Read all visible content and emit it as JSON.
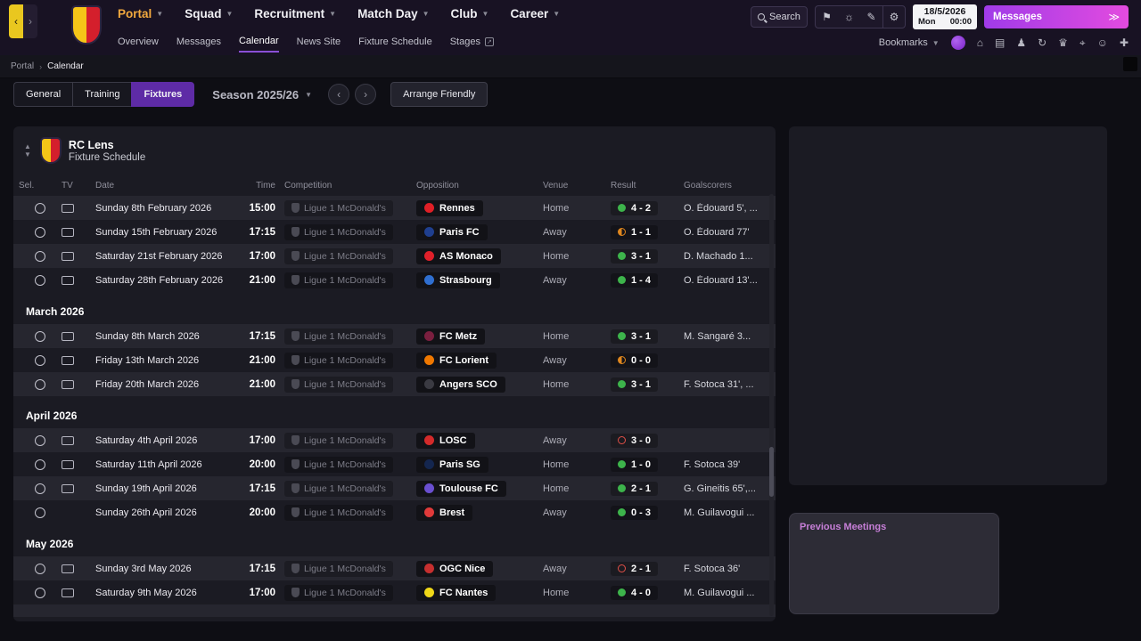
{
  "colors": {
    "accent_purple": "#5e2ba6",
    "underline_purple": "#8a4fd6",
    "messages_gradient_left": "#a03be8",
    "messages_gradient_right": "#e34bdf",
    "win_green": "#3db44b",
    "draw_orange": "#e0871e",
    "loss_red": "#e25048",
    "portal_accent": "#f2a93e"
  },
  "topbar": {
    "nav": [
      {
        "label": "Portal",
        "accent": true
      },
      {
        "label": "Squad"
      },
      {
        "label": "Recruitment"
      },
      {
        "label": "Match Day"
      },
      {
        "label": "Club"
      },
      {
        "label": "Career"
      }
    ],
    "subnav": [
      {
        "label": "Overview"
      },
      {
        "label": "Messages"
      },
      {
        "label": "Calendar",
        "active": true
      },
      {
        "label": "News Site"
      },
      {
        "label": "Fixture Schedule"
      },
      {
        "label": "Stages",
        "external": true
      }
    ],
    "search_placeholder": "Search",
    "quick_icons": [
      {
        "name": "flag-icon",
        "glyph": "⚑"
      },
      {
        "name": "bulb-icon",
        "glyph": "☼"
      },
      {
        "name": "pencil-icon",
        "glyph": "✎"
      },
      {
        "name": "settings-gear-icon",
        "glyph": "⚙"
      }
    ],
    "date": "18/5/2026",
    "day": "Mon",
    "time": "00:00",
    "messages_label": "Messages",
    "messages_arrows": "≫",
    "bookmarks_label": "Bookmarks",
    "shortcut_icons": [
      {
        "name": "stadium-icon",
        "glyph": "⌂"
      },
      {
        "name": "inbox-icon",
        "glyph": "▤"
      },
      {
        "name": "tactics-icon",
        "glyph": "♟"
      },
      {
        "name": "sync-icon",
        "glyph": "↻"
      },
      {
        "name": "competition-icon",
        "glyph": "♛"
      },
      {
        "name": "scouting-icon",
        "glyph": "⌖"
      },
      {
        "name": "squad-icon",
        "glyph": "☺"
      },
      {
        "name": "medical-icon",
        "glyph": "✚"
      }
    ]
  },
  "breadcrumb": {
    "root": "Portal",
    "separator": "›",
    "current": "Calendar"
  },
  "tabs": {
    "items": [
      {
        "label": "General"
      },
      {
        "label": "Training"
      },
      {
        "label": "Fixtures",
        "active": true
      }
    ],
    "season": "Season 2025/26",
    "arrange_friendly": "Arrange Friendly"
  },
  "schedule": {
    "club": "RC Lens",
    "subtitle": "Fixture Schedule",
    "columns": [
      "Sel.",
      "TV",
      "Date",
      "Time",
      "Competition",
      "Opposition",
      "Venue",
      "Result",
      "Goalscorers"
    ],
    "groups": [
      {
        "month": "",
        "rows": [
          {
            "tv": true,
            "date": "Sunday 8th February 2026",
            "time": "15:00",
            "competition": "Ligue 1 McDonald's",
            "opposition": "Rennes",
            "badge_color": "#e01f26",
            "venue": "Home",
            "result": "4 - 2",
            "outcome": "win",
            "scorers": "O. Édouard 5', ..."
          },
          {
            "tv": true,
            "date": "Sunday 15th February 2026",
            "time": "17:15",
            "competition": "Ligue 1 McDonald's",
            "opposition": "Paris FC",
            "badge_color": "#1f3f8f",
            "venue": "Away",
            "result": "1 - 1",
            "outcome": "draw",
            "scorers": "O. Édouard 77'"
          },
          {
            "tv": true,
            "date": "Saturday 21st February 2026",
            "time": "17:00",
            "competition": "Ligue 1 McDonald's",
            "opposition": "AS Monaco",
            "badge_color": "#e0202a",
            "venue": "Home",
            "result": "3 - 1",
            "outcome": "win",
            "scorers": "D. Machado 1..."
          },
          {
            "tv": true,
            "date": "Saturday 28th February 2026",
            "time": "21:00",
            "competition": "Ligue 1 McDonald's",
            "opposition": "Strasbourg",
            "badge_color": "#2f6fd0",
            "venue": "Away",
            "result": "1 - 4",
            "outcome": "win",
            "scorers": "O. Édouard 13'..."
          }
        ]
      },
      {
        "month": "March 2026",
        "rows": [
          {
            "tv": true,
            "date": "Sunday 8th March 2026",
            "time": "17:15",
            "competition": "Ligue 1 McDonald's",
            "opposition": "FC Metz",
            "badge_color": "#7a1f3f",
            "venue": "Home",
            "result": "3 - 1",
            "outcome": "win",
            "scorers": "M. Sangaré 3..."
          },
          {
            "tv": true,
            "date": "Friday 13th March 2026",
            "time": "21:00",
            "competition": "Ligue 1 McDonald's",
            "opposition": "FC Lorient",
            "badge_color": "#f07800",
            "venue": "Away",
            "result": "0 - 0",
            "outcome": "draw",
            "scorers": ""
          },
          {
            "tv": true,
            "date": "Friday 20th March 2026",
            "time": "21:00",
            "competition": "Ligue 1 McDonald's",
            "opposition": "Angers SCO",
            "badge_color": "#3a3a42",
            "venue": "Home",
            "result": "3 - 1",
            "outcome": "win",
            "scorers": "F. Sotoca 31', ..."
          }
        ]
      },
      {
        "month": "April 2026",
        "rows": [
          {
            "tv": true,
            "date": "Saturday 4th April 2026",
            "time": "17:00",
            "competition": "Ligue 1 McDonald's",
            "opposition": "LOSC",
            "badge_color": "#d42a2a",
            "venue": "Away",
            "result": "3 - 0",
            "outcome": "loss",
            "scorers": ""
          },
          {
            "tv": true,
            "date": "Saturday 11th April 2026",
            "time": "20:00",
            "competition": "Ligue 1 McDonald's",
            "opposition": "Paris SG",
            "badge_color": "#14264f",
            "venue": "Home",
            "result": "1 - 0",
            "outcome": "win",
            "scorers": "F. Sotoca 39'"
          },
          {
            "tv": true,
            "date": "Sunday 19th April 2026",
            "time": "17:15",
            "competition": "Ligue 1 McDonald's",
            "opposition": "Toulouse FC",
            "badge_color": "#6a4fd0",
            "venue": "Home",
            "result": "2 - 1",
            "outcome": "win",
            "scorers": "G. Gineitis 65',..."
          },
          {
            "tv": false,
            "date": "Sunday 26th April 2026",
            "time": "20:00",
            "competition": "Ligue 1 McDonald's",
            "opposition": "Brest",
            "badge_color": "#e03a3a",
            "venue": "Away",
            "result": "0 - 3",
            "outcome": "win",
            "scorers": "M. Guilavogui ..."
          }
        ]
      },
      {
        "month": "May 2026",
        "rows": [
          {
            "tv": true,
            "date": "Sunday 3rd May 2026",
            "time": "17:15",
            "competition": "Ligue 1 McDonald's",
            "opposition": "OGC Nice",
            "badge_color": "#c62f2f",
            "venue": "Away",
            "result": "2 - 1",
            "outcome": "loss",
            "scorers": "F. Sotoca 36'"
          },
          {
            "tv": true,
            "date": "Saturday 9th May 2026",
            "time": "17:00",
            "competition": "Ligue 1 McDonald's",
            "opposition": "FC Nantes",
            "badge_color": "#f0d818",
            "venue": "Home",
            "result": "4 - 0",
            "outcome": "win",
            "scorers": "M. Guilavogui ..."
          }
        ]
      }
    ]
  },
  "sidebar": {
    "previous_meetings": "Previous Meetings"
  }
}
